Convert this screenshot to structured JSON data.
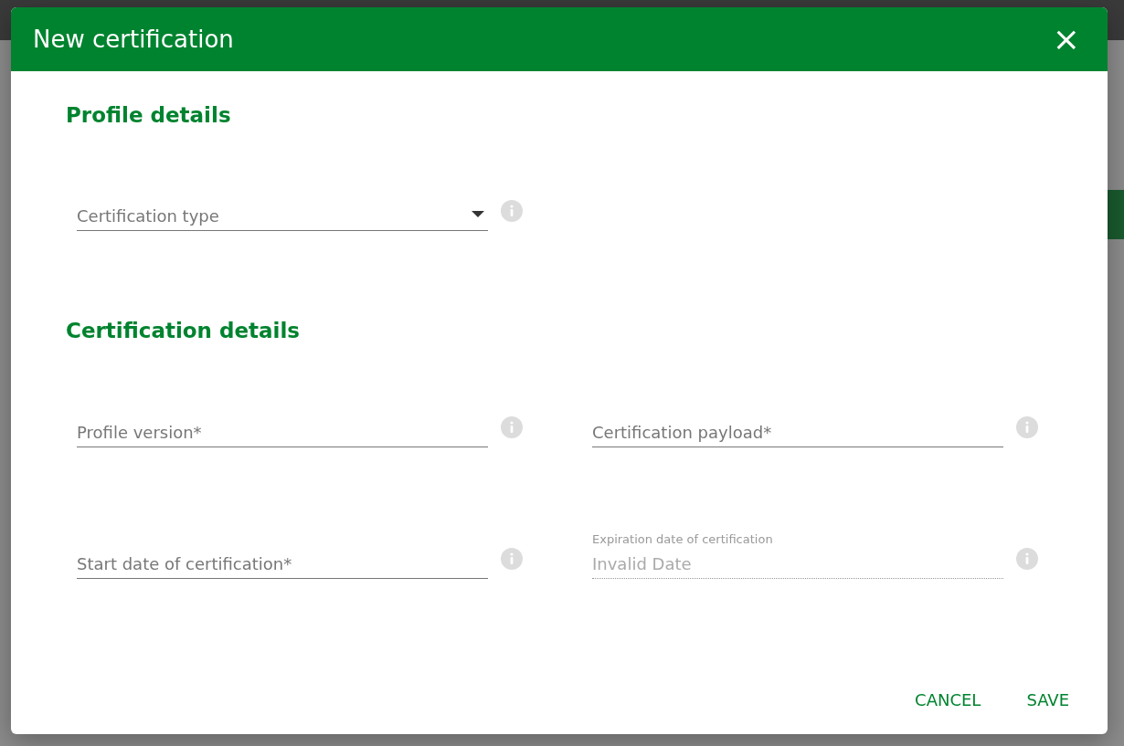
{
  "dialog": {
    "title": "New certification",
    "close_icon": "×",
    "sections": [
      {
        "heading": "Profile details",
        "rows": [
          [
            {
              "kind": "select",
              "label": "Certification type",
              "disabled": false
            }
          ]
        ]
      },
      {
        "heading": "Certification details",
        "rows": [
          [
            {
              "kind": "text",
              "label": "Profile version*",
              "disabled": false
            },
            {
              "kind": "text",
              "label": "Certification payload*",
              "disabled": false
            }
          ],
          [
            {
              "kind": "date",
              "label": "Start date of certification*",
              "disabled": false
            },
            {
              "kind": "date",
              "label": "Expiration date of certification",
              "value": "Invalid Date",
              "disabled": true
            }
          ]
        ]
      }
    ],
    "buttons": [
      "CANCEL",
      "SAVE"
    ]
  }
}
